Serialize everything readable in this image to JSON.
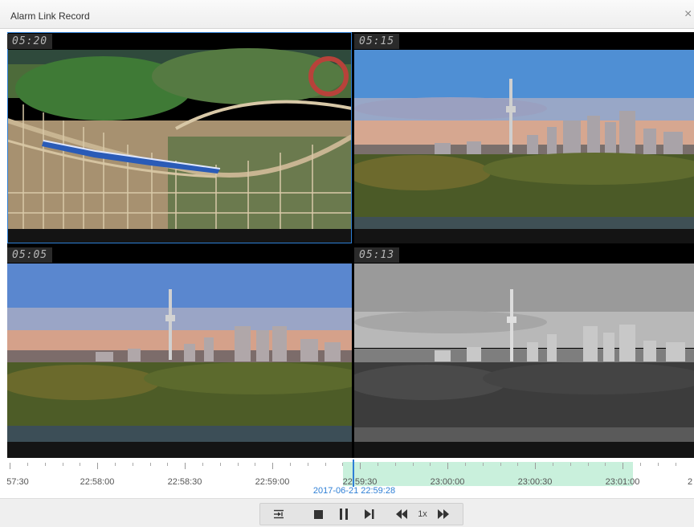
{
  "window": {
    "title": "Alarm Link Record",
    "close_glyph": "×"
  },
  "video_tiles": [
    {
      "osd_time": "05:20",
      "scene": "roller-coaster",
      "selected": true
    },
    {
      "osd_time": "05:15",
      "scene": "city-skyline-color"
    },
    {
      "osd_time": "05:05",
      "scene": "city-skyline-color"
    },
    {
      "osd_time": "05:13",
      "scene": "city-skyline-grayscale"
    }
  ],
  "timeline": {
    "labels": [
      "57:30",
      "22:58:00",
      "22:58:30",
      "22:59:00",
      "22:59:30",
      "23:00:00",
      "23:00:30",
      "23:01:00",
      "2"
    ],
    "current_time": "2017-06-21 22:59:28",
    "recorded_range_color": "#c9f0dc",
    "cursor_color": "#2e7fd6"
  },
  "controls": {
    "speed_label": "1x",
    "icons": [
      "clip-icon",
      "stop-icon",
      "pause-icon",
      "step-forward-icon",
      "slow-down-icon",
      "speed-up-icon"
    ]
  }
}
